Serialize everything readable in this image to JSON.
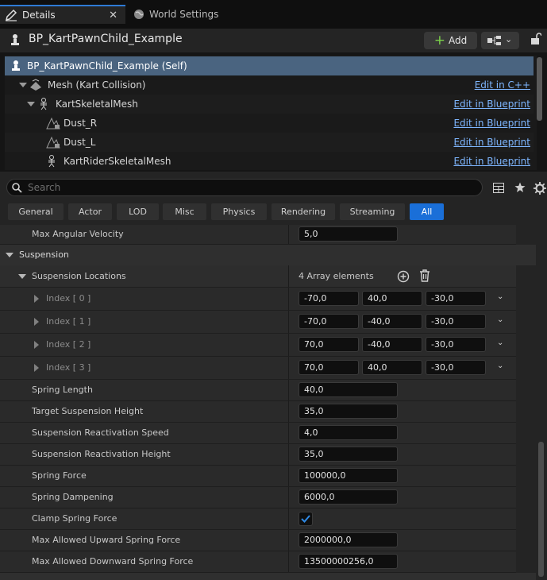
{
  "tabs": {
    "details": "Details",
    "world_settings": "World Settings"
  },
  "header": {
    "title": "BP_KartPawnChild_Example",
    "add_label": "Add"
  },
  "components": [
    {
      "label": "BP_KartPawnChild_Example (Self)",
      "action": ""
    },
    {
      "label": "Mesh (Kart Collision)",
      "action": "Edit in C++"
    },
    {
      "label": "KartSkeletalMesh",
      "action": "Edit in Blueprint"
    },
    {
      "label": "Dust_R",
      "action": "Edit in Blueprint"
    },
    {
      "label": "Dust_L",
      "action": "Edit in Blueprint"
    },
    {
      "label": "KartRiderSkeletalMesh",
      "action": "Edit in Blueprint"
    }
  ],
  "search": {
    "placeholder": "Search"
  },
  "filters": [
    "General",
    "Actor",
    "LOD",
    "Misc",
    "Physics",
    "Rendering",
    "Streaming",
    "All"
  ],
  "active_filter": "All",
  "properties": {
    "max_angular_velocity": {
      "label": "Max Angular Velocity",
      "value": "5,0"
    },
    "suspension_category": "Suspension",
    "suspension_locations": {
      "label": "Suspension Locations",
      "summary": "4 Array elements",
      "items": [
        {
          "label": "Index [ 0 ]",
          "x": "-70,0",
          "y": "40,0",
          "z": "-30,0"
        },
        {
          "label": "Index [ 1 ]",
          "x": "-70,0",
          "y": "-40,0",
          "z": "-30,0"
        },
        {
          "label": "Index [ 2 ]",
          "x": "70,0",
          "y": "-40,0",
          "z": "-30,0"
        },
        {
          "label": "Index [ 3 ]",
          "x": "70,0",
          "y": "40,0",
          "z": "-30,0"
        }
      ]
    },
    "spring_length": {
      "label": "Spring Length",
      "value": "40,0"
    },
    "target_suspension_height": {
      "label": "Target Suspension Height",
      "value": "35,0"
    },
    "suspension_reactivation_speed": {
      "label": "Suspension Reactivation Speed",
      "value": "4,0"
    },
    "suspension_reactivation_height": {
      "label": "Suspension Reactivation Height",
      "value": "35,0"
    },
    "spring_force": {
      "label": "Spring Force",
      "value": "100000,0"
    },
    "spring_dampening": {
      "label": "Spring Dampening",
      "value": "6000,0"
    },
    "clamp_spring_force": {
      "label": "Clamp Spring Force",
      "checked": true
    },
    "max_upward_spring_force": {
      "label": "Max Allowed Upward Spring Force",
      "value": "2000000,0"
    },
    "max_downward_spring_force": {
      "label": "Max Allowed Downward Spring Force",
      "value": "13500000256,0"
    }
  },
  "colors": {
    "accent": "#1a6fd8",
    "selection": "#4a6480",
    "link": "#7eb6ff"
  }
}
